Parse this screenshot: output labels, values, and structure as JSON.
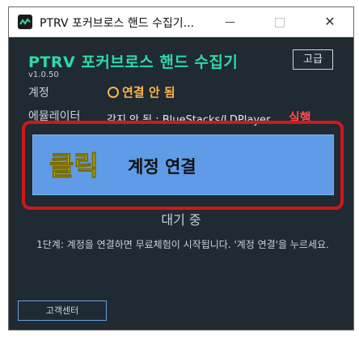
{
  "window": {
    "title": "PTRV 포커브로스 핸드 수집기...",
    "close_label": "✕"
  },
  "header": {
    "app_title": "PTRV 포커브로스 핸드 수집기",
    "version": "v1.0.50",
    "advanced_label": "고급"
  },
  "account": {
    "label": "계정",
    "status": "연결 안 됨"
  },
  "emulator": {
    "label": "에뮬레이터",
    "status": "감지 안 됨 : BlueStacks/LDPlayer",
    "run_label": "실행"
  },
  "connect": {
    "click_label": "클릭",
    "button_label": "계정 연결"
  },
  "status_text": "대기 중",
  "hint_text": "1단계: 계정을 연결하면 무료체험이 시작됩니다. '계정 연결'을 누르세요.",
  "footer": {
    "support_label": "고객센터"
  },
  "colors": {
    "background": "#1f2a33",
    "accent": "#2fd9a6",
    "warning": "#ffb74a",
    "danger": "#ff4d4d",
    "button": "#5f9be6"
  }
}
